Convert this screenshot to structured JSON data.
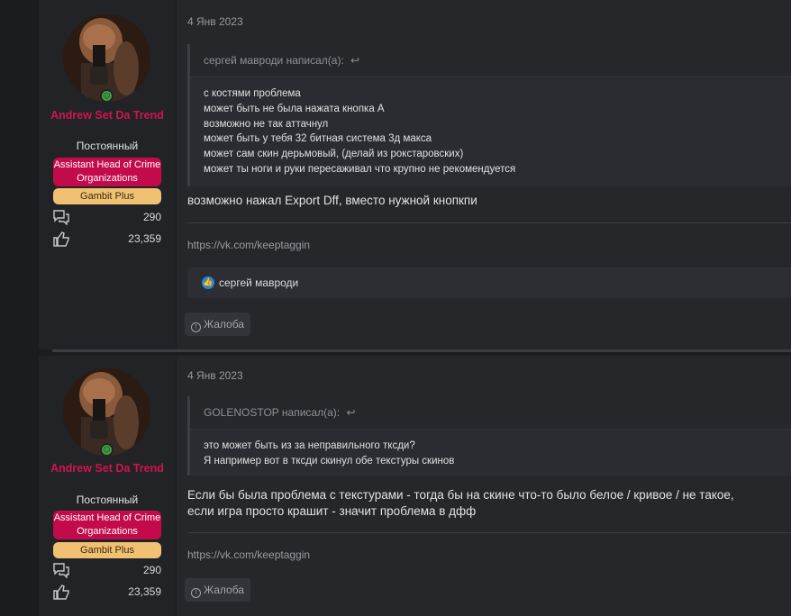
{
  "posts": [
    {
      "author": {
        "name": "Andrew Set Da Trend",
        "title": "Постоянный",
        "banner_red": "Assistant Head of Crime Organizations",
        "banner_gold": "Gambit Plus",
        "messages_count": "290",
        "reactions_count": "23,359"
      },
      "date": "4 Янв 2023",
      "quote": {
        "author_line": "сергей мавроди написал(а):",
        "lines": [
          "с костями проблема",
          "может быть не была нажата кнопка А",
          "возможно не так аттачнул",
          "может быть у тебя 32 битная система 3д макса",
          "может сам скин дерьмовый, (делай из рокстаровских)",
          "может ты ноги и руки пересаживал что крупно не рекомендуется"
        ]
      },
      "message_lines": [
        "возможно нажал Export Dff, вместо нужной кнопкпи"
      ],
      "signature": "https://vk.com/keeptaggin",
      "likes": {
        "user": "сергей мавроди"
      },
      "report_label": "Жалоба"
    },
    {
      "author": {
        "name": "Andrew Set Da Trend",
        "title": "Постоянный",
        "banner_red": "Assistant Head of Crime Organizations",
        "banner_gold": "Gambit Plus",
        "messages_count": "290",
        "reactions_count": "23,359"
      },
      "date": "4 Янв 2023",
      "quote": {
        "author_line": "GOLENOSTOP написал(а):",
        "lines": [
          "это может быть из за неправильного тксди?",
          "Я например вот в тксди скинул обе текстуры скинов"
        ]
      },
      "message_lines": [
        "Если бы была проблема с текстурами - тогда бы на скине что-то было белое / кривое / не такое,",
        "если игра просто крашит - значит проблема в дфф"
      ],
      "signature": "https://vk.com/keeptaggin",
      "report_label": "Жалоба"
    }
  ],
  "colors": {
    "username": "#d0154b",
    "banner_red": "#c30b4b",
    "banner_gold": "#f1c173",
    "online": "#41a042",
    "like_blue": "#2d86d6"
  },
  "icons": [
    "online-indicator-icon",
    "messages-icon",
    "reactions-icon",
    "reply-arrow-icon",
    "like-icon",
    "report-icon"
  ]
}
